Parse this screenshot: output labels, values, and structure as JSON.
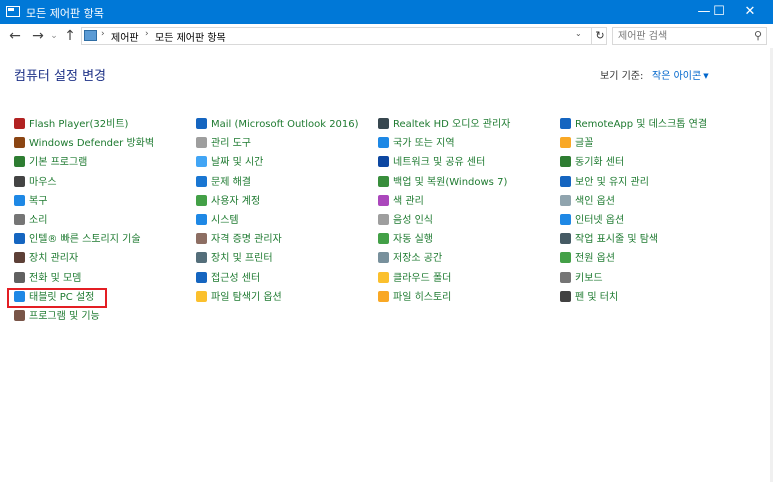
{
  "window": {
    "title": "모든 제어판 항목",
    "minimize": "—",
    "maximize": "☐",
    "close": "✕"
  },
  "address": {
    "back": "←",
    "forward": "→",
    "recent": "⌄",
    "up": "↑",
    "crumb_sep": "›",
    "crumbs": [
      "제어판",
      "모든 제어판 항목"
    ],
    "dropdown": "⌄",
    "refresh": "↻",
    "search_placeholder": "제어판 검색",
    "search_icon": "⚲"
  },
  "content": {
    "heading": "컴퓨터 설정 변경",
    "view_by_label": "보기 기준:",
    "view_by_value": "작은 아이콘",
    "view_by_caret": "▼"
  },
  "columns": [
    [
      {
        "label": "Flash Player(32비트)",
        "icon": "flash-icon",
        "color": "#b22222"
      },
      {
        "label": "Windows Defender 방화벽",
        "icon": "firewall-icon",
        "color": "#8b4513"
      },
      {
        "label": "기본 프로그램",
        "icon": "default-programs-icon",
        "color": "#2e7d32"
      },
      {
        "label": "마우스",
        "icon": "mouse-icon",
        "color": "#444444"
      },
      {
        "label": "복구",
        "icon": "recovery-icon",
        "color": "#1e88e5"
      },
      {
        "label": "소리",
        "icon": "sound-icon",
        "color": "#757575"
      },
      {
        "label": "인텔® 빠른 스토리지 기술",
        "icon": "intel-storage-icon",
        "color": "#1565c0"
      },
      {
        "label": "장치 관리자",
        "icon": "device-manager-icon",
        "color": "#5d4037"
      },
      {
        "label": "전화 및 모뎀",
        "icon": "phone-modem-icon",
        "color": "#616161"
      },
      {
        "label": "태블릿 PC 설정",
        "icon": "tablet-pc-icon",
        "color": "#1e88e5"
      },
      {
        "label": "프로그램 및 기능",
        "icon": "programs-features-icon",
        "color": "#795548"
      }
    ],
    [
      {
        "label": "Mail (Microsoft Outlook 2016)",
        "icon": "mail-icon",
        "color": "#1565c0"
      },
      {
        "label": "관리 도구",
        "icon": "admin-tools-icon",
        "color": "#9e9e9e"
      },
      {
        "label": "날짜 및 시간",
        "icon": "date-time-icon",
        "color": "#42a5f5"
      },
      {
        "label": "문제 해결",
        "icon": "troubleshoot-icon",
        "color": "#1976d2"
      },
      {
        "label": "사용자 계정",
        "icon": "user-accounts-icon",
        "color": "#43a047"
      },
      {
        "label": "시스템",
        "icon": "system-icon",
        "color": "#1e88e5"
      },
      {
        "label": "자격 증명 관리자",
        "icon": "credential-manager-icon",
        "color": "#8d6e63"
      },
      {
        "label": "장치 및 프린터",
        "icon": "devices-printers-icon",
        "color": "#546e7a"
      },
      {
        "label": "접근성 센터",
        "icon": "ease-of-access-icon",
        "color": "#1565c0"
      },
      {
        "label": "파일 탐색기 옵션",
        "icon": "file-explorer-options-icon",
        "color": "#fbc02d"
      }
    ],
    [
      {
        "label": "Realtek HD 오디오 관리자",
        "icon": "realtek-audio-icon",
        "color": "#37474f"
      },
      {
        "label": "국가 또는 지역",
        "icon": "region-icon",
        "color": "#1e88e5"
      },
      {
        "label": "네트워크 및 공유 센터",
        "icon": "network-sharing-icon",
        "color": "#0d47a1"
      },
      {
        "label": "백업 및 복원(Windows 7)",
        "icon": "backup-restore-icon",
        "color": "#388e3c"
      },
      {
        "label": "색 관리",
        "icon": "color-management-icon",
        "color": "#ab47bc"
      },
      {
        "label": "음성 인식",
        "icon": "speech-recognition-icon",
        "color": "#9e9e9e"
      },
      {
        "label": "자동 실행",
        "icon": "autoplay-icon",
        "color": "#43a047"
      },
      {
        "label": "저장소 공간",
        "icon": "storage-spaces-icon",
        "color": "#78909c"
      },
      {
        "label": "클라우드 폴더",
        "icon": "cloud-folder-icon",
        "color": "#fbc02d"
      },
      {
        "label": "파일 히스토리",
        "icon": "file-history-icon",
        "color": "#f9a825"
      }
    ],
    [
      {
        "label": "RemoteApp 및 데스크톱 연결",
        "icon": "remoteapp-icon",
        "color": "#1565c0"
      },
      {
        "label": "글꼴",
        "icon": "fonts-icon",
        "color": "#f9a825"
      },
      {
        "label": "동기화 센터",
        "icon": "sync-center-icon",
        "color": "#2e7d32"
      },
      {
        "label": "보안 및 유지 관리",
        "icon": "security-maintenance-icon",
        "color": "#1565c0"
      },
      {
        "label": "색인 옵션",
        "icon": "indexing-options-icon",
        "color": "#90a4ae"
      },
      {
        "label": "인터넷 옵션",
        "icon": "internet-options-icon",
        "color": "#1e88e5"
      },
      {
        "label": "작업 표시줄 및 탐색",
        "icon": "taskbar-navigation-icon",
        "color": "#455a64"
      },
      {
        "label": "전원 옵션",
        "icon": "power-options-icon",
        "color": "#43a047"
      },
      {
        "label": "키보드",
        "icon": "keyboard-icon",
        "color": "#757575"
      },
      {
        "label": "펜 및 터치",
        "icon": "pen-touch-icon",
        "color": "#424242"
      }
    ]
  ]
}
